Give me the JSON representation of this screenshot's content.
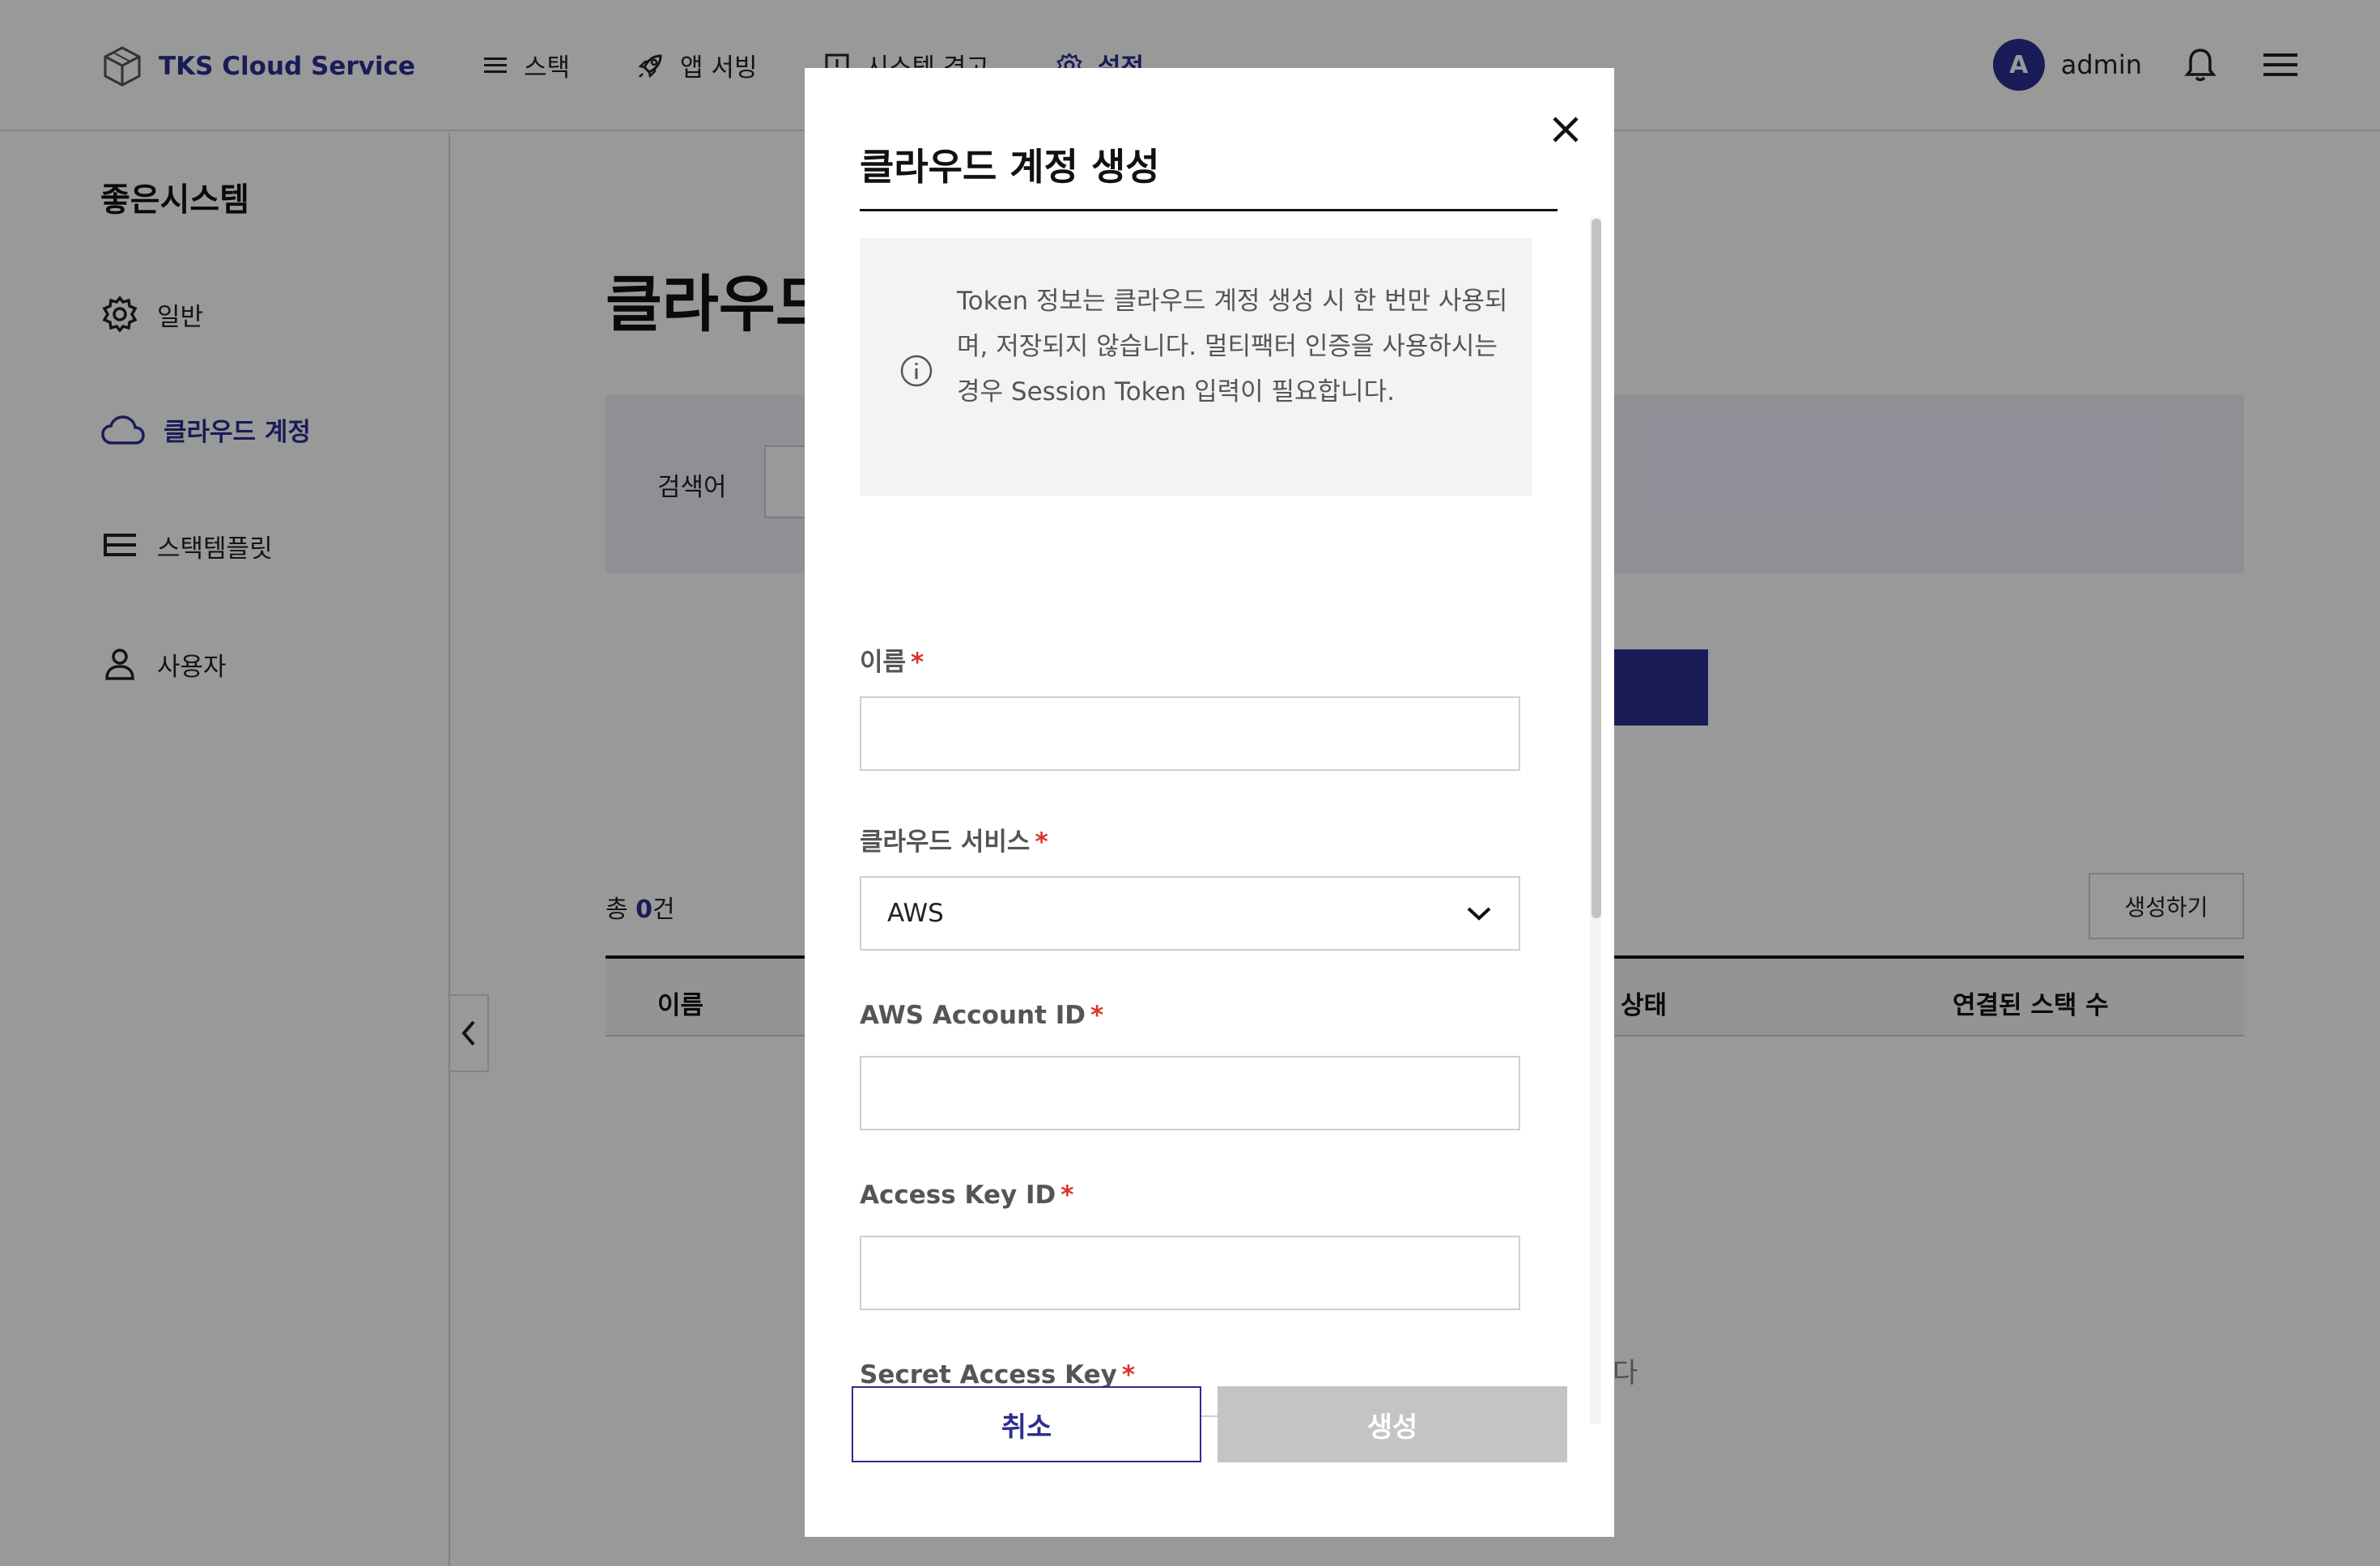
{
  "header": {
    "logo_text": "TKS Cloud Service",
    "nav": [
      {
        "label": "스택",
        "icon": "stack-icon"
      },
      {
        "label": "앱 서빙",
        "icon": "rocket-icon"
      },
      {
        "label": "시스템 경고",
        "icon": "alert-icon"
      },
      {
        "label": "설정",
        "icon": "gear-icon"
      }
    ],
    "avatar_initial": "A",
    "user_name": "admin"
  },
  "sidebar": {
    "org_name": "좋은시스템",
    "items": [
      {
        "label": "일반",
        "icon": "gear-icon"
      },
      {
        "label": "클라우드 계정",
        "icon": "cloud-icon",
        "active": true
      },
      {
        "label": "스택템플릿",
        "icon": "stack-icon"
      },
      {
        "label": "사용자",
        "icon": "user-icon"
      }
    ]
  },
  "main": {
    "title": "클라우드 계정",
    "search_label": "검색어",
    "total_prefix": "총 ",
    "total_count": "0",
    "total_suffix": "건",
    "create_button": "생성하기",
    "columns": [
      "이름",
      "상태",
      "연결된 스택 수"
    ],
    "empty_text": "다"
  },
  "modal": {
    "title": "클라우드 계정 생성",
    "info": "Token 정보는 클라우드 계정 생성 시 한 번만 사용되며, 저장되지 않습니다. 멀티팩터 인증을 사용하시는 경우 Session Token 입력이 필요합니다.",
    "fields": {
      "name_label": "이름",
      "cloud_service_label": "클라우드 서비스",
      "cloud_service_value": "AWS",
      "account_id_label": "AWS Account ID",
      "access_key_label": "Access Key ID",
      "secret_key_label": "Secret Access Key"
    },
    "required_mark": "*",
    "cancel_button": "취소",
    "submit_button": "생성"
  }
}
